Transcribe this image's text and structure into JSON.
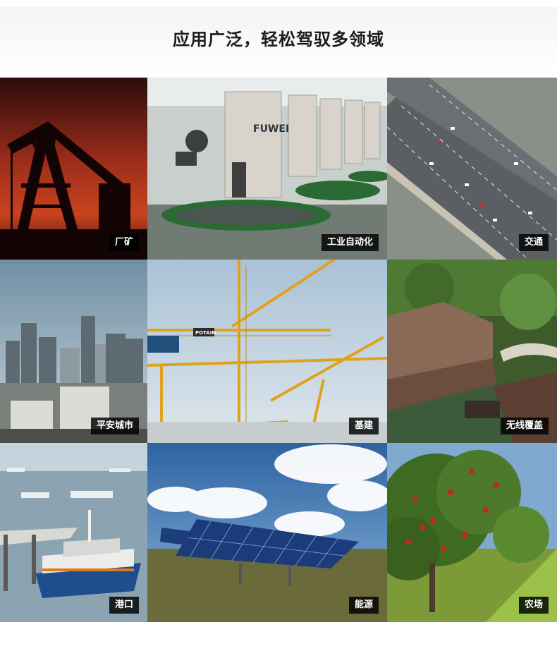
{
  "header": {
    "title": "应用广泛，轻松驾驭多领域"
  },
  "tiles": [
    {
      "label": "厂矿"
    },
    {
      "label": "工业自动化"
    },
    {
      "label": "交通"
    },
    {
      "label": "平安城市"
    },
    {
      "label": "基建"
    },
    {
      "label": "无线覆盖"
    },
    {
      "label": "港口"
    },
    {
      "label": "能源"
    },
    {
      "label": "农场"
    }
  ],
  "photo_text": {
    "machine_brand": "FUWEI",
    "crane_brand": "POTAIN"
  },
  "colors": {
    "label_bg": "#000000",
    "label_text": "#ffffff",
    "title_text": "#1c1c1c"
  }
}
